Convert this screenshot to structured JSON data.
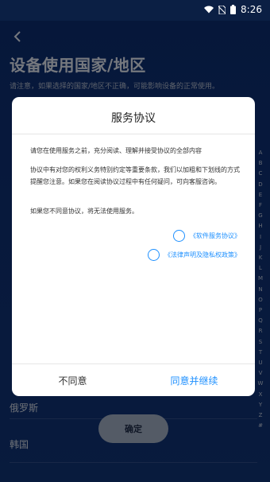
{
  "status_bar": {
    "time": "8:26"
  },
  "header": {
    "title": "设备使用国家/地区",
    "notice": "请注意，如果选择的国家/地区不正确，可能影响设备的正常使用。"
  },
  "list": {
    "items": [
      "俄罗斯",
      "韩国"
    ]
  },
  "confirm_button": {
    "label": "确定"
  },
  "index_letters": [
    "A",
    "B",
    "C",
    "D",
    "E",
    "F",
    "G",
    "H",
    "I",
    "J",
    "K",
    "L",
    "M",
    "N",
    "O",
    "P",
    "Q",
    "R",
    "S",
    "T",
    "U",
    "V",
    "W",
    "X",
    "Y",
    "Z",
    "#"
  ],
  "dialog": {
    "title": "服务协议",
    "paragraphs": [
      "请您在使用服务之前，充分阅读、理解并接受协议的全部内容",
      "协议中有对您的权利义务特别约定等重要条款，我们以加粗和下划线的方式提醒您注意。如果您在阅读协议过程中有任何疑问，可向客服咨询。",
      "如果您不同意协议，将无法使用服务。"
    ],
    "agreements": [
      "《软件服务协议》",
      "《法律声明及隐私权政策》"
    ],
    "disagree_label": "不同意",
    "agree_label": "同意并继续"
  },
  "colors": {
    "accent": "#1e90ff",
    "background": "#0e2e6e"
  }
}
